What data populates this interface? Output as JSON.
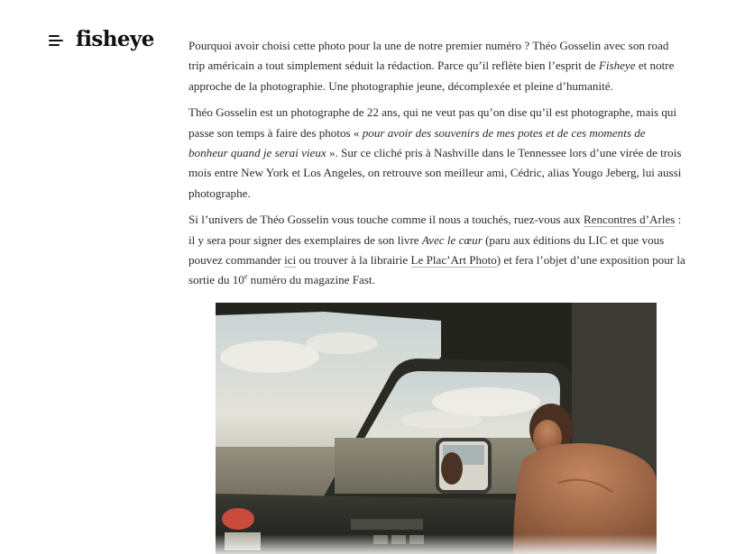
{
  "header": {
    "logo": "fisheye",
    "menu_icon": "hamburger-menu-icon"
  },
  "article": {
    "p1": {
      "t1": "Pourquoi avoir choisi cette photo pour la une de notre premier numéro ? Théo Gosselin avec son road trip américain a tout simplement séduit la rédaction. Parce qu’il reflète bien l’esprit de ",
      "em1": "Fisheye",
      "t2": " et notre approche de la photographie. Une photographie jeune, décomplexée et pleine d’humanité."
    },
    "p2": {
      "t1": "Théo Gosselin est un photographe de 22 ans, qui ne veut pas qu’on dise qu’il est photographe, mais qui passe son temps à faire des photos « ",
      "em1": "pour avoir des souvenirs de mes potes et de ces moments de bonheur quand je serai vieux",
      "t2": " ». Sur ce cliché pris à Nashville dans le Tennessee lors d’une virée de trois mois entre New York et Los Angeles, on retrouve son meilleur ami, Cédric, alias Yougo Jeberg, lui aussi photographe."
    },
    "p3": {
      "t1": "Si l’univers de Théo Gosselin vous touche comme il nous a touchés, ruez-vous aux ",
      "link1": "Rencontres d’Arles",
      "t2": " : il y sera pour signer des exemplaires de son livre ",
      "em1": "Avec le cœur",
      "t3": " (paru aux éditions du LIC et que vous pouvez commander ",
      "link2": "ici",
      "t4": " ou trouver à la librairie ",
      "link3": "Le Plac’Art Photo",
      "t5": ") et fera l’objet d’une exposition pour la sortie du 10",
      "sup": "e",
      "t6": " numéro du magazine Fast."
    }
  },
  "photo": {
    "subject": "truck-interior-road-trip-photo"
  },
  "colors": {
    "text": "#2a2a2a",
    "logo": "#111111",
    "link_underline": "#b5b5b5"
  }
}
